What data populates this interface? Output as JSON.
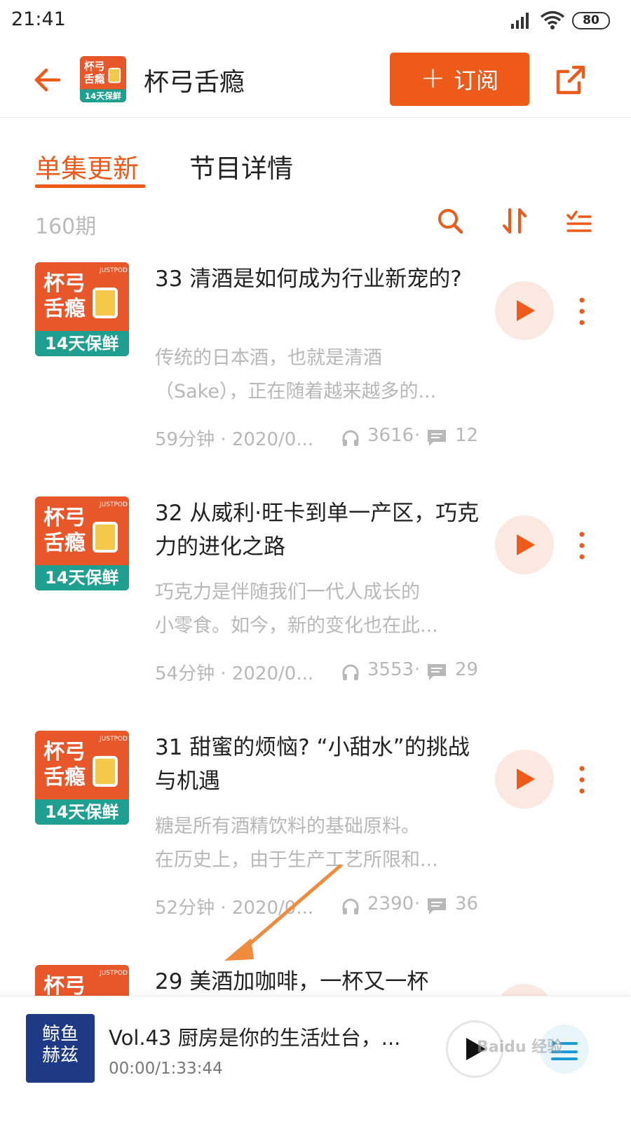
{
  "status_bar": {
    "time": "21:41",
    "battery": "80"
  },
  "header": {
    "title": "杯弓舌瘾",
    "subscribe_label": "订阅",
    "subscribe_plus": "+"
  },
  "cover": {
    "line1": "杯弓",
    "line2": "舌瘾",
    "badge": "14天保鲜",
    "brand": "JUSTPOD"
  },
  "tabs": [
    {
      "label": "单集更新"
    },
    {
      "label": "节目详情"
    }
  ],
  "list_header": {
    "count": "160期"
  },
  "episodes": [
    {
      "title": "33 清酒是如何成为行业新宠的?",
      "desc_line1": "传统的日本酒，也就是清酒",
      "desc_line2": "（Sake），正在随着越来越多的...",
      "duration_date": "59分钟 · 2020/0...",
      "plays": "3616",
      "sep": "·",
      "comments": "12"
    },
    {
      "title": "32 从威利·旺卡到单一产区，巧克力的进化之路",
      "desc_line1": "巧克力是伴随我们一代人成长的",
      "desc_line2": "小零食。如今，新的变化也在此...",
      "duration_date": "54分钟 · 2020/0...",
      "plays": "3553",
      "sep": "·",
      "comments": "29"
    },
    {
      "title": "31 甜蜜的烦恼? “小甜水”的挑战与机遇",
      "desc_line1": "糖是所有酒精饮料的基础原料。",
      "desc_line2": "在历史上，由于生产工艺所限和...",
      "duration_date": "52分钟 · 2020/0...",
      "plays": "2390",
      "sep": "·",
      "comments": "36"
    },
    {
      "title": "29 美酒加咖啡，一杯又一杯",
      "desc_line1": "",
      "desc_line2": "",
      "duration_date": "",
      "plays": "",
      "sep": "",
      "comments": ""
    }
  ],
  "player": {
    "cover_text_line1": "鲸鱼",
    "cover_text_line2": "赫兹",
    "title": "Vol.43 厨房是你的生活灶台，...",
    "time": "00:00/1:33:44"
  },
  "watermark": "Baidu 经验",
  "colors": {
    "accent": "#ee5a1a",
    "cover_orange": "#e8572a",
    "cover_teal": "#1f9f8f",
    "play_bg": "#fbe9e1",
    "muted": "#b8b8b8"
  },
  "icons": [
    "back-arrow-icon",
    "share-icon",
    "search-icon",
    "sort-icon",
    "filter-list-icon",
    "play-icon",
    "more-vertical-icon",
    "headphone-icon",
    "comment-icon",
    "playlist-icon",
    "signal-icon",
    "wifi-icon"
  ]
}
